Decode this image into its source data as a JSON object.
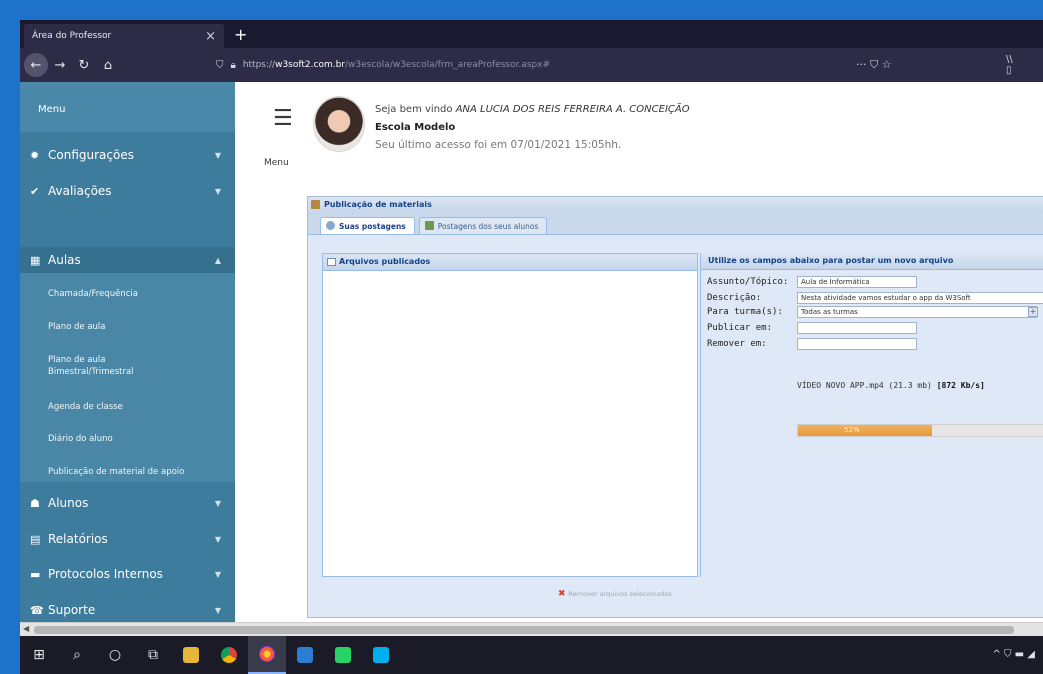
{
  "browser": {
    "tab_title": "Área do Professor",
    "tab_close": "×",
    "new_tab": "+",
    "url_domain": "w3soft2.com.br",
    "url_rest": "/w3escola/w3escola/frm_areaProfessor.aspx#",
    "url_prefix": "https://",
    "page_actions": "··· ⛉ ☆",
    "far_right": "\\\\ ▯"
  },
  "sidebar": {
    "menu_label": "Menu",
    "items": [
      {
        "label": "Configurações",
        "icon": "gear-icon",
        "glyph": "✹"
      },
      {
        "label": "Avaliações",
        "icon": "check-icon",
        "glyph": "✔"
      },
      {
        "label": "Aulas",
        "icon": "calendar-icon",
        "glyph": "▦"
      },
      {
        "label": "Alunos",
        "icon": "student-icon",
        "glyph": "☗"
      },
      {
        "label": "Relatórios",
        "icon": "report-icon",
        "glyph": "▤"
      },
      {
        "label": "Protocolos Internos",
        "icon": "chat-icon",
        "glyph": "▬"
      },
      {
        "label": "Suporte",
        "icon": "phone-icon",
        "glyph": "☎"
      }
    ],
    "sub_items": [
      "Chamada/Frequência",
      "Plano de aula",
      "Plano de aula Bimestral/Trimestral",
      "Agenda de classe",
      "Diário do aluno",
      "Publicação de material de apoio"
    ]
  },
  "header": {
    "menu_label": "Menu",
    "welcome_prefix": "Seja bem vindo",
    "user_name": "ANA LUCIA DOS REIS FERREIRA A. CONCEIÇÃO",
    "school": "Escola Modelo",
    "last_access": "Seu último acesso foi em 07/01/2021 15:05hh."
  },
  "panel": {
    "title": "Publicação de materiais",
    "tabs": [
      "Suas postagens",
      "Postagens dos seus alunos"
    ],
    "left_header": "Arquivos publicados",
    "remove_label": "Remover arquivos selecionados",
    "right_header": "Utilize os campos abaixo para postar um novo arquivo",
    "fields": {
      "subject_label": "Assunto/Tópico:",
      "subject_value": "Aula de Informática",
      "description_label": "Descrição:",
      "description_value": "Nesta atividade vamos estudar o app da W3Soft",
      "classes_label": "Para turma(s):",
      "classes_value": "Todas as turmas",
      "publish_label": "Publicar em:",
      "publish_value": "",
      "remove_label": "Remover em:",
      "remove_value": ""
    },
    "upload": {
      "file_text": "VÍDEO NOVO APP.mp4 (21.3 mb)",
      "speed": "[872 Kb/s]",
      "progress_text": "52%",
      "progress": 0.54
    }
  },
  "taskbar": {
    "apps": [
      "windows-icon",
      "search-icon",
      "cortana-icon",
      "task-view-icon",
      "file-explorer-icon",
      "chrome-icon",
      "firefox-icon",
      "app-icon",
      "phone-icon",
      "skype-icon"
    ],
    "tray": "^ ⛉ ▬ ◢"
  },
  "colors": {
    "sidebar": "#3d7c9d",
    "sidebar_sub": "#4a87a6",
    "progress": "#e49a3b"
  }
}
